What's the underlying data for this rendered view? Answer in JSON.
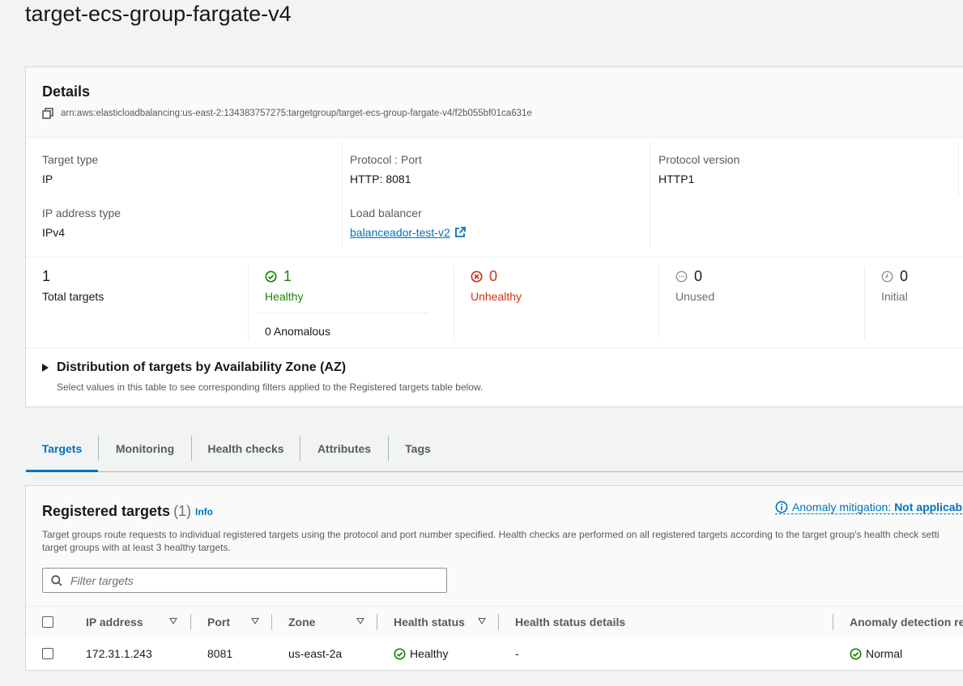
{
  "page": {
    "title": "target-ecs-group-fargate-v4"
  },
  "details": {
    "title": "Details",
    "arn": "arn:aws:elasticloadbalancing:us-east-2:134383757275:targetgroup/target-ecs-group-fargate-v4/f2b055bf01ca631e",
    "target_type_label": "Target type",
    "target_type_value": "IP",
    "protocol_port_label": "Protocol : Port",
    "protocol_port_value": "HTTP: 8081",
    "protocol_version_label": "Protocol version",
    "protocol_version_value": "HTTP1",
    "ip_address_type_label": "IP address type",
    "ip_address_type_value": "IPv4",
    "load_balancer_label": "Load balancer",
    "load_balancer_value": "balanceador-test-v2"
  },
  "stats": {
    "total": {
      "value": "1",
      "label": "Total targets"
    },
    "healthy": {
      "value": "1",
      "label": "Healthy",
      "anomalous": "0 Anomalous"
    },
    "unhealthy": {
      "value": "0",
      "label": "Unhealthy"
    },
    "unused": {
      "value": "0",
      "label": "Unused"
    },
    "initial": {
      "value": "0",
      "label": "Initial"
    }
  },
  "az_distribution": {
    "title": "Distribution of targets by Availability Zone (AZ)",
    "description": "Select values in this table to see corresponding filters applied to the Registered targets table below."
  },
  "tabs": [
    "Targets",
    "Monitoring",
    "Health checks",
    "Attributes",
    "Tags"
  ],
  "registered_targets": {
    "title": "Registered targets",
    "count": "(1)",
    "info": "Info",
    "anomaly_label": "Anomaly mitigation:",
    "anomaly_value": "Not applicab",
    "desc_line1": "Target groups route requests to individual registered targets using the protocol and port number specified. Health checks are performed on all registered targets according to the target group's health check setti",
    "desc_line2": "target groups with at least 3 healthy targets.",
    "filter_placeholder": "Filter targets",
    "columns": {
      "ip": "IP address",
      "port": "Port",
      "zone": "Zone",
      "health_status": "Health status",
      "health_details": "Health status details",
      "anomaly": "Anomaly detection re"
    },
    "rows": [
      {
        "ip": "172.31.1.243",
        "port": "8081",
        "zone": "us-east-2a",
        "health_status": "Healthy",
        "health_details": "-",
        "anomaly": "Normal"
      }
    ]
  },
  "colors": {
    "accent": "#0073bb",
    "healthy": "#1d8102",
    "unhealthy": "#d13212",
    "neutral": "#687078"
  },
  "icons": [
    "copy-icon",
    "check-circle-icon",
    "x-circle-icon",
    "ellipsis-circle-icon",
    "clock-icon",
    "external-link-icon",
    "info-icon",
    "search-icon",
    "caret-right-icon",
    "sort-icon"
  ]
}
